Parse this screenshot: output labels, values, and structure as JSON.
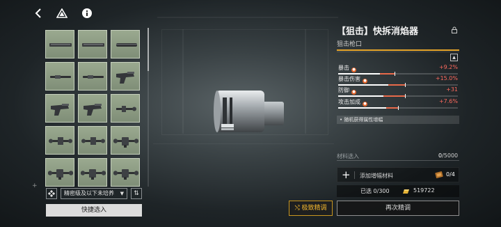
{
  "nav": {
    "back_icon": "back-arrow-icon",
    "drive_icon": "triangle-logo-icon",
    "info_icon": "info-icon"
  },
  "inventory": {
    "items": [
      {
        "kind": "barrel-long"
      },
      {
        "kind": "barrel-long"
      },
      {
        "kind": "suppressor-long"
      },
      {
        "kind": "barrel-thin"
      },
      {
        "kind": "barrel-thin"
      },
      {
        "kind": "grip-block"
      },
      {
        "kind": "grip-block"
      },
      {
        "kind": "grip-block"
      },
      {
        "kind": "scope-small"
      },
      {
        "kind": "scope-medium"
      },
      {
        "kind": "scope-medium"
      },
      {
        "kind": "scope-long"
      },
      {
        "kind": "scope-long"
      },
      {
        "kind": "scope-long"
      },
      {
        "kind": "scope-long"
      }
    ],
    "filter_label": "精密级及以下未培养",
    "quick_select_label": "快捷选入"
  },
  "detail": {
    "title": "【狙击】快拆消焰器",
    "subtitle": "狙击枪口",
    "stats": [
      {
        "name": "暴击",
        "value": "+9.2%",
        "base": 0.35,
        "bonus": 0.12
      },
      {
        "name": "暴击伤害",
        "value": "+15.0%",
        "base": 0.42,
        "bonus": 0.14
      },
      {
        "name": "防御",
        "value": "+31",
        "base": 0.38,
        "bonus": 0.18
      },
      {
        "name": "攻击加成",
        "value": "+7.6%",
        "base": 0.4,
        "bonus": 0.1
      }
    ],
    "random_text": "• 随机获得属性增幅",
    "material": {
      "label": "材料选入",
      "current": "0",
      "max": "/5000"
    },
    "add_material_label": "添加增幅材料",
    "add_material_count": "0/4",
    "selected_label": "已选 0/300",
    "gold_value": "519722",
    "extreme_button": "极致精调",
    "again_button": "再次精调"
  },
  "colors": {
    "accent": "#e6a52a",
    "stat_value": "#ff6a5e",
    "stat_dot": "#e0642b"
  }
}
